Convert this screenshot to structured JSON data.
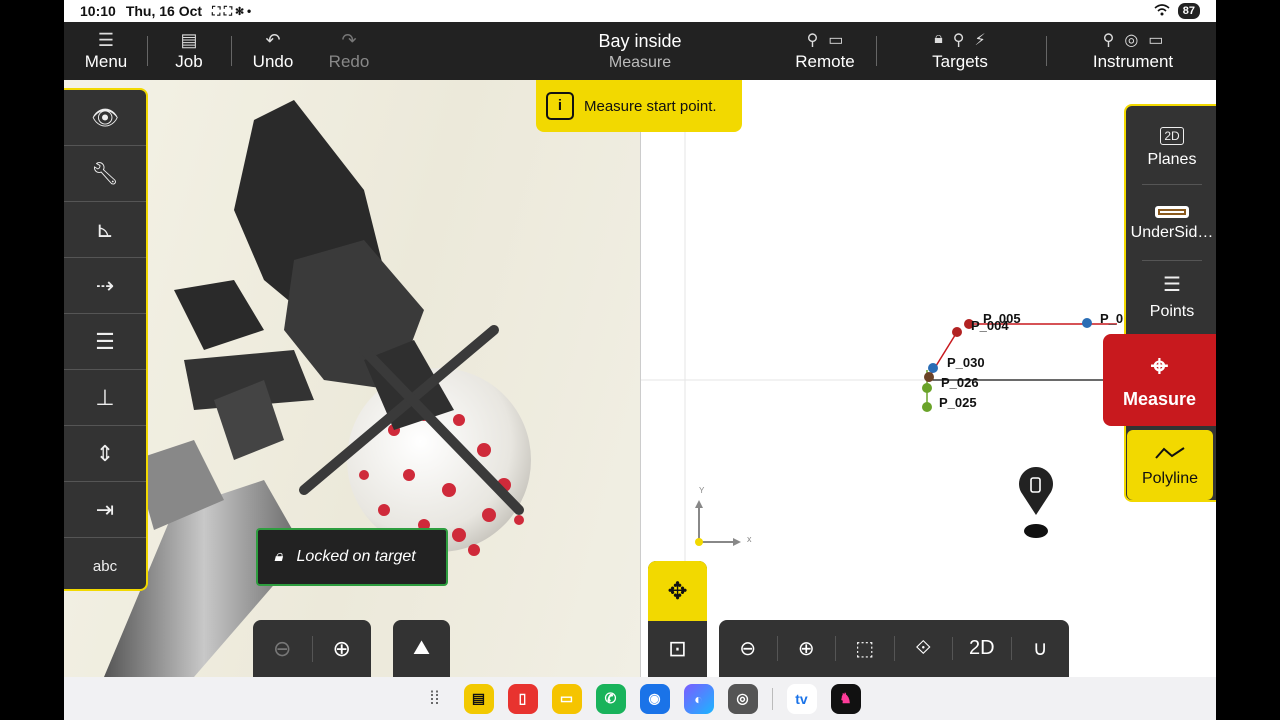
{
  "status_bar": {
    "time": "10:10",
    "date": "Thu, 16 Oct",
    "indicators": "⛶ ⛶ ✽ •",
    "wifi": "wifi-icon",
    "battery": "87"
  },
  "topbar": {
    "menu_label": "Menu",
    "job_label": "Job",
    "undo_label": "Undo",
    "redo_label": "Redo",
    "title": "Bay inside",
    "subtitle": "Measure",
    "remote_label": "Remote",
    "targets_label": "Targets",
    "instrument_label": "Instrument"
  },
  "hint": {
    "icon": "i",
    "text": "Measure start point."
  },
  "camera": {
    "locked_text": "Locked on target",
    "left_tools_last_label": "abc"
  },
  "right_panel": {
    "planes_label": "Planes",
    "planes_badge": "2D",
    "layer_label": "UnderSid…",
    "points_label": "Points",
    "measure_label": "Measure",
    "polyline_label": "Polyline"
  },
  "map": {
    "points": [
      {
        "label": "P_005",
        "color": "#b22222"
      },
      {
        "label": "P_004",
        "color": "#b22222"
      },
      {
        "label": "P_0",
        "color": "#2a6db5"
      },
      {
        "label": "P_030",
        "color": "#2a6db5"
      },
      {
        "label": "P_026",
        "color": "#6b4226"
      },
      {
        "label": "P_025",
        "color": "#6aa329"
      }
    ],
    "axis_x": "x",
    "axis_y": "Y"
  },
  "colors": {
    "accent": "#f2d900",
    "measure": "#c8191e",
    "toolbar": "#333333",
    "locked_border": "#2e9d3f"
  }
}
